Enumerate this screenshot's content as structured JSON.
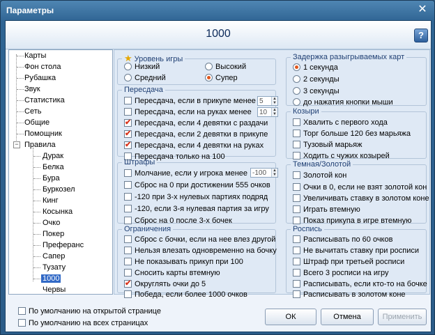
{
  "window": {
    "title": "Параметры",
    "close_glyph": "✕"
  },
  "header": {
    "title": "1000",
    "help_glyph": "?"
  },
  "tree": {
    "items": [
      "Карты",
      "Фон стола",
      "Рубашка",
      "Звук",
      "Статистика",
      "Сеть",
      "Общие",
      "Помощник",
      "Правила"
    ],
    "expander_glyph": "−",
    "rules_children": [
      "Дурак",
      "Белка",
      "Бура",
      "Буркозел",
      "Кинг",
      "Косынка",
      "Очко",
      "Покер",
      "Преферанс",
      "Сапер",
      "Тузату",
      "1000",
      "Червы"
    ],
    "selected": "1000"
  },
  "level": {
    "title": "Уровень игры",
    "options": [
      {
        "label": "Низкий",
        "selected": false
      },
      {
        "label": "Высокий",
        "selected": false
      },
      {
        "label": "Средний",
        "selected": false
      },
      {
        "label": "Супер",
        "selected": true
      }
    ]
  },
  "redeal": {
    "title": "Пересдача",
    "items": [
      {
        "label": "Пересдача, если в прикупе менее",
        "checked": false,
        "spin": "5"
      },
      {
        "label": "Пересдача, если на руках менее",
        "checked": false,
        "spin": "10"
      },
      {
        "label": "Пересдача, если 4 девятки с раздачи",
        "checked": true
      },
      {
        "label": "Пересдача, если 2 девятки в прикупе",
        "checked": true
      },
      {
        "label": "Пересдача, если 4 девятки на руках",
        "checked": true
      },
      {
        "label": "Пересдача только на 100",
        "checked": false
      }
    ]
  },
  "fines": {
    "title": "Штрафы",
    "items": [
      {
        "label": "Молчание, если у игрока менее",
        "checked": false,
        "spin": "-100"
      },
      {
        "label": "Сброс на 0 при достижении 555 очков",
        "checked": false
      },
      {
        "label": "-120 при 3-х нулевых партиях подряд",
        "checked": false
      },
      {
        "label": "-120, если 3-я нулевая партия за игру",
        "checked": false
      },
      {
        "label": "Сброс на 0 после 3-х бочек",
        "checked": false
      }
    ]
  },
  "limits": {
    "title": "Ограничения",
    "items": [
      {
        "label": "Сброс с бочки, если на нее влез другой",
        "checked": false
      },
      {
        "label": "Нельзя влезать одновременно на бочку",
        "checked": false
      },
      {
        "label": "Не показывать прикуп при 100",
        "checked": false
      },
      {
        "label": "Сносить карты втемную",
        "checked": false
      },
      {
        "label": "Округлять очки до 5",
        "checked": true
      },
      {
        "label": "Победа, если более 1000 очков",
        "checked": false
      }
    ]
  },
  "delay": {
    "title": "Задержка разыгрываемых карт",
    "options": [
      {
        "label": "1 секунда",
        "selected": true
      },
      {
        "label": "2 секунды",
        "selected": false
      },
      {
        "label": "3 секунды",
        "selected": false
      },
      {
        "label": "до нажатия кнопки мыши",
        "selected": false
      }
    ]
  },
  "trumps": {
    "title": "Козыри",
    "items": [
      {
        "label": "Хвалить с первого хода",
        "checked": false
      },
      {
        "label": "Торг больше 120 без марьяжа",
        "checked": false
      },
      {
        "label": "Тузовый марьяж",
        "checked": false
      },
      {
        "label": "Ходить с чужих козырей",
        "checked": false
      }
    ]
  },
  "dark": {
    "title": "Темная/Золотой",
    "items": [
      {
        "label": "Золотой кон",
        "checked": false
      },
      {
        "label": "Очки в 0, если не взят золотой кон",
        "checked": false
      },
      {
        "label": "Увеличивать ставку в золотом коне",
        "checked": false
      },
      {
        "label": "Играть втемную",
        "checked": false
      },
      {
        "label": "Показ прикупа в игре втемную",
        "checked": false
      }
    ]
  },
  "sign": {
    "title": "Роспись",
    "items": [
      {
        "label": "Расписывать по 60 очков",
        "checked": false
      },
      {
        "label": "Не вычитать ставку при росписи",
        "checked": false
      },
      {
        "label": "Штраф при третьей росписи",
        "checked": false
      },
      {
        "label": "Всего 3 росписи на игру",
        "checked": false
      },
      {
        "label": "Расписывать, если кто-то на бочке",
        "checked": false
      },
      {
        "label": "Расписывать в золотом коне",
        "checked": false
      }
    ]
  },
  "footer": {
    "default_open": "По умолчанию на открытой странице",
    "default_all": "По умолчанию на всех страницах",
    "ok": "ОК",
    "cancel": "Отмена",
    "apply": "Применить"
  },
  "icons": {
    "star": "★"
  }
}
